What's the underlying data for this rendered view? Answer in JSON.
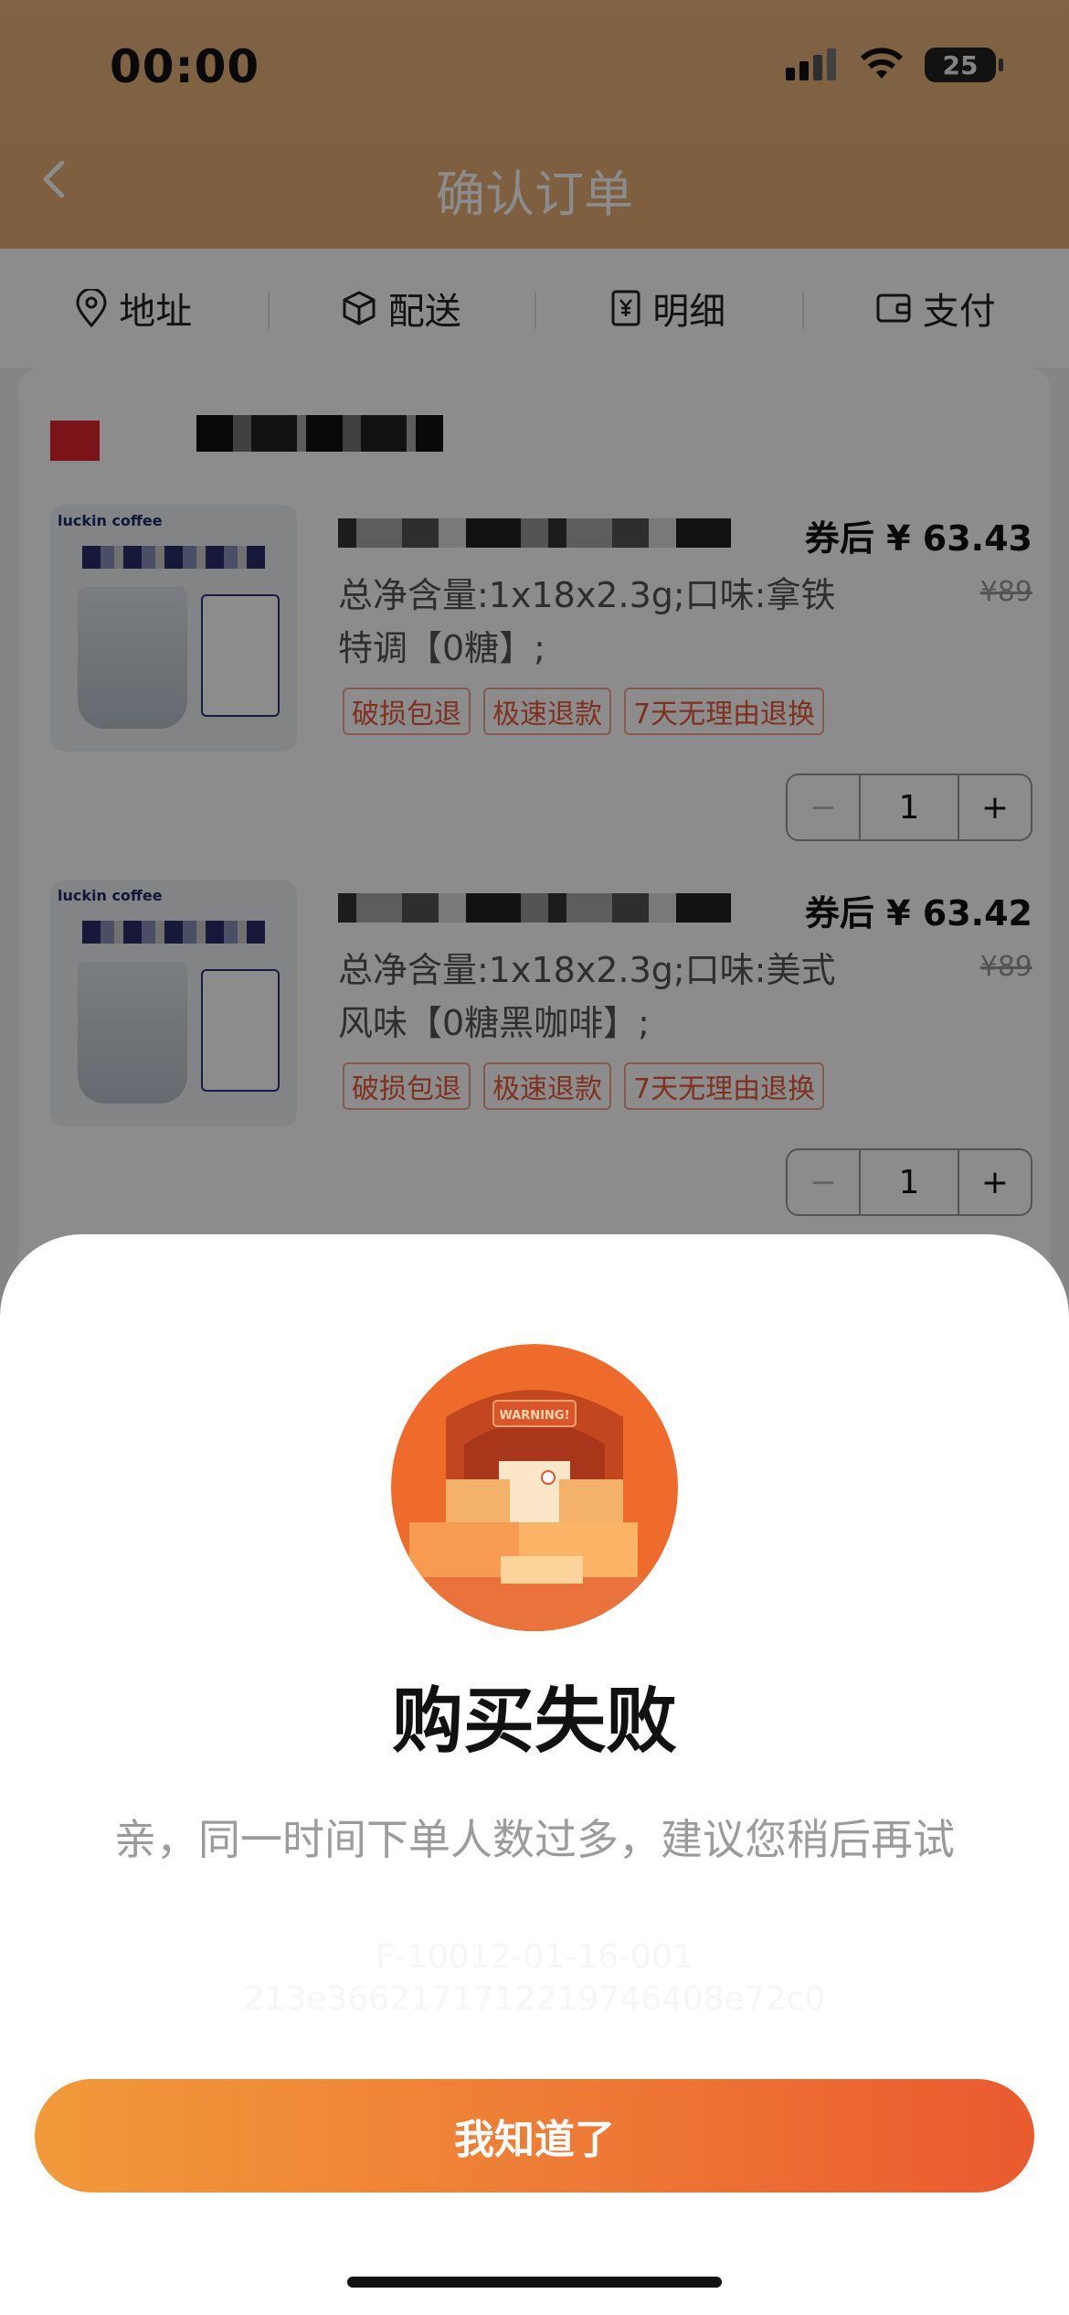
{
  "status": {
    "time": "00:00",
    "battery": "25"
  },
  "header": {
    "title": "确认订单"
  },
  "steps": [
    {
      "icon": "location-pin-icon",
      "label": "地址"
    },
    {
      "icon": "box-icon",
      "label": "配送"
    },
    {
      "icon": "receipt-yen-icon",
      "label": "明细"
    },
    {
      "icon": "wallet-icon",
      "label": "支付"
    }
  ],
  "products": [
    {
      "brand": "luckin coffee",
      "price": "券后 ¥ 63.43",
      "original_price": "¥89",
      "spec": "总净含量:1x18x2.3g;口味:拿铁特调【0糖】;",
      "tags": [
        "破损包退",
        "极速退款",
        "7天无理由退换"
      ],
      "quantity": "1"
    },
    {
      "brand": "luckin coffee",
      "price": "券后 ¥ 63.42",
      "original_price": "¥89",
      "spec": "总净含量:1x18x2.3g;口味:美式风味【0糖黑咖啡】;",
      "tags": [
        "破损包退",
        "极速退款",
        "7天无理由退换"
      ],
      "quantity": "1"
    }
  ],
  "stepper": {
    "minus": "−",
    "plus": "+"
  },
  "dialog": {
    "illustration_label": "WARNING!",
    "title": "购买失败",
    "message": "亲，同一时间下单人数过多，建议您稍后再试",
    "error_code": "F-10012-01-16-001",
    "trace_id": "213e3662171712219746408e72c0",
    "button_label": "我知道了"
  },
  "colors": {
    "accent": "#ee7a35",
    "header": "#e6b07a",
    "tag_border": "#f0a48e"
  }
}
